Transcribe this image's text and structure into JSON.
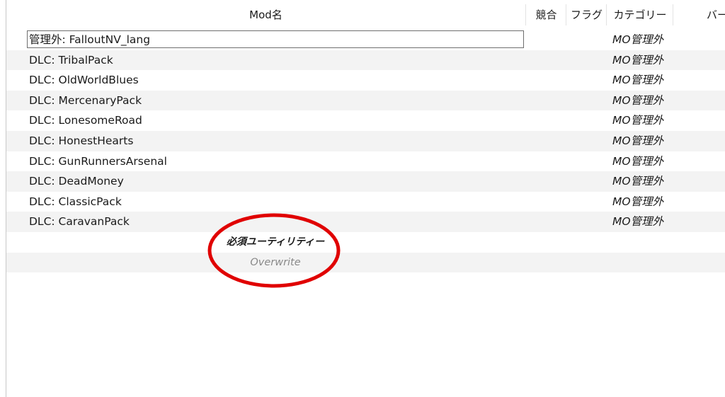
{
  "columns": {
    "name": "Mod名",
    "conflicts": "競合",
    "flags": "フラグ",
    "category": "カテゴリー",
    "version": "バー"
  },
  "rows": [
    {
      "name": "管理外: FalloutNV_lang",
      "category": "MO管理外",
      "selected": true
    },
    {
      "name": "DLC: TribalPack",
      "category": "MO管理外"
    },
    {
      "name": "DLC: OldWorldBlues",
      "category": "MO管理外"
    },
    {
      "name": "DLC: MercenaryPack",
      "category": "MO管理外"
    },
    {
      "name": "DLC: LonesomeRoad",
      "category": "MO管理外"
    },
    {
      "name": "DLC: HonestHearts",
      "category": "MO管理外"
    },
    {
      "name": "DLC: GunRunnersArsenal",
      "category": "MO管理外"
    },
    {
      "name": "DLC: DeadMoney",
      "category": "MO管理外"
    },
    {
      "name": "DLC: ClassicPack",
      "category": "MO管理外"
    },
    {
      "name": "DLC: CaravanPack",
      "category": "MO管理外"
    }
  ],
  "separator": "必須ユーティリティー",
  "overwrite": "Overwrite",
  "colors": {
    "annotation_circle": "#e00000",
    "alt_row": "#f3f3f3",
    "overwrite_text": "#8a8a8a"
  }
}
